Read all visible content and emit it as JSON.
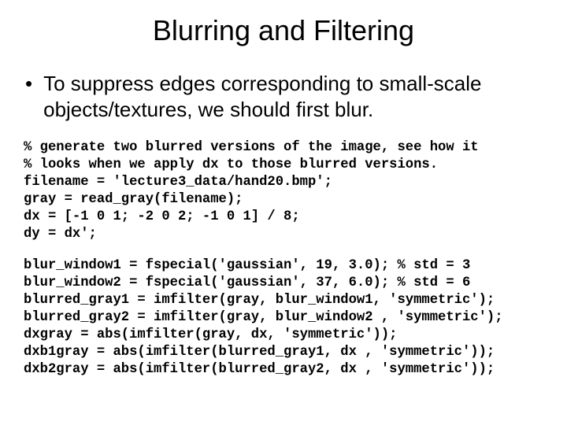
{
  "title": "Blurring and Filtering",
  "bullet": {
    "dot": "•",
    "text": "To suppress edges corresponding to small-scale objects/textures, we should first blur."
  },
  "code1": "% generate two blurred versions of the image, see how it\n% looks when we apply dx to those blurred versions.\nfilename = 'lecture3_data/hand20.bmp';\ngray = read_gray(filename);\ndx = [-1 0 1; -2 0 2; -1 0 1] / 8;\ndy = dx';",
  "code2": "blur_window1 = fspecial('gaussian', 19, 3.0); % std = 3\nblur_window2 = fspecial('gaussian', 37, 6.0); % std = 6\nblurred_gray1 = imfilter(gray, blur_window1, 'symmetric');\nblurred_gray2 = imfilter(gray, blur_window2 , 'symmetric');\ndxgray = abs(imfilter(gray, dx, 'symmetric'));\ndxb1gray = abs(imfilter(blurred_gray1, dx , 'symmetric'));\ndxb2gray = abs(imfilter(blurred_gray2, dx , 'symmetric'));"
}
